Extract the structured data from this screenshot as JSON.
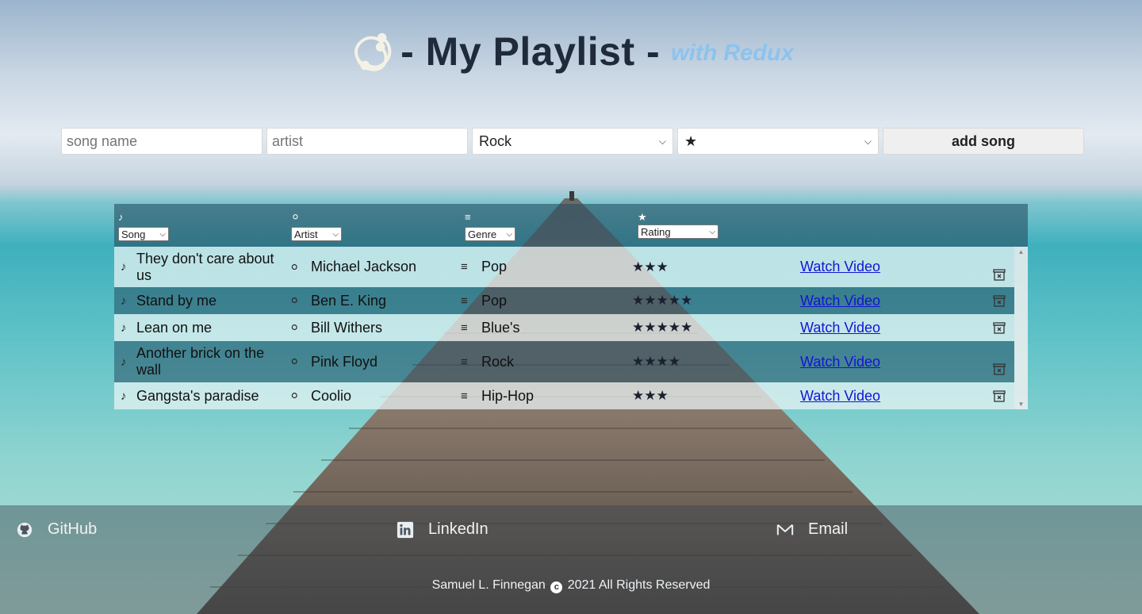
{
  "header": {
    "title": "- My Playlist -",
    "subtitle": "with Redux"
  },
  "form": {
    "song_placeholder": "song name",
    "artist_placeholder": "artist",
    "genre_selected": "Rock",
    "rating_selected": "★",
    "submit_label": "add song"
  },
  "table": {
    "headers": [
      {
        "icon": "music-note-icon",
        "sort_label": "Song"
      },
      {
        "icon": "user-icon",
        "sort_label": "Artist"
      },
      {
        "icon": "list-icon",
        "sort_label": "Genre"
      },
      {
        "icon": "star-icon",
        "sort_label": "Rating"
      }
    ],
    "rows": [
      {
        "song": "They don't care about us",
        "artist": "Michael Jackson",
        "genre": "Pop",
        "rating": "★★★",
        "link": "Watch Video"
      },
      {
        "song": "Stand by me",
        "artist": "Ben E. King",
        "genre": "Pop",
        "rating": "★★★★★",
        "link": "Watch Video"
      },
      {
        "song": "Lean on me",
        "artist": "Bill Withers",
        "genre": "Blue's",
        "rating": "★★★★★",
        "link": "Watch Video"
      },
      {
        "song": "Another brick on the wall",
        "artist": "Pink Floyd",
        "genre": "Rock",
        "rating": "★★★★",
        "link": "Watch Video"
      },
      {
        "song": "Gangsta's paradise",
        "artist": "Coolio",
        "genre": "Hip-Hop",
        "rating": "★★★",
        "link": "Watch Video"
      }
    ]
  },
  "footer": {
    "github": "GitHub",
    "linkedin": "LinkedIn",
    "email": "Email",
    "copyright_name": "Samuel L. Finnegan",
    "copyright_year": "2021 All Rights Reserved"
  }
}
